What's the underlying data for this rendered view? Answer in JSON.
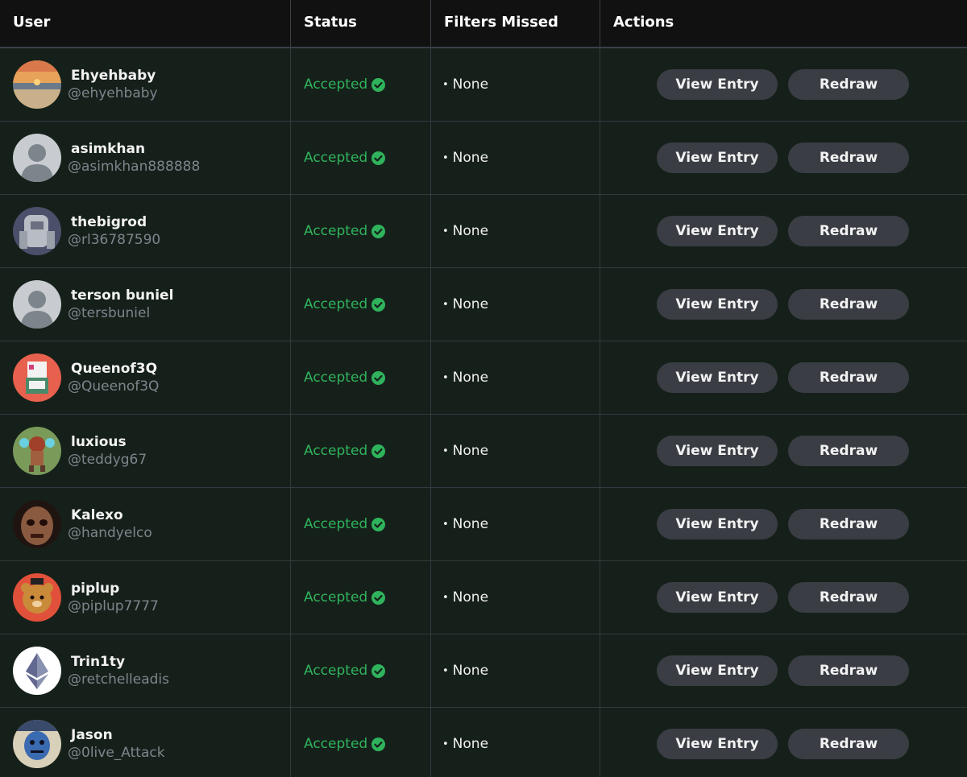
{
  "columns": {
    "user": "User",
    "status": "Status",
    "filters": "Filters Missed",
    "actions": "Actions"
  },
  "rows": [
    {
      "name": "Ehyehbaby",
      "handle": "@ehyehbaby",
      "status": "Accepted",
      "filters": "None",
      "avatar": "sunset-avatar"
    },
    {
      "name": "asimkhan",
      "handle": "@asimkhan888888",
      "status": "Accepted",
      "filters": "None",
      "avatar": "default-avatar"
    },
    {
      "name": "thebigrod",
      "handle": "@rl36787590",
      "status": "Accepted",
      "filters": "None",
      "avatar": "robot-avatar"
    },
    {
      "name": "terson buniel",
      "handle": "@tersbuniel",
      "status": "Accepted",
      "filters": "None",
      "avatar": "default-avatar"
    },
    {
      "name": "Queenof3Q",
      "handle": "@Queenof3Q",
      "status": "Accepted",
      "filters": "None",
      "avatar": "pixel-creature-avatar"
    },
    {
      "name": "luxious",
      "handle": "@teddyg67",
      "status": "Accepted",
      "filters": "None",
      "avatar": "bug-robot-avatar"
    },
    {
      "name": "Kalexo",
      "handle": "@handyelco",
      "status": "Accepted",
      "filters": "None",
      "avatar": "skull-face-avatar"
    },
    {
      "name": "piplup",
      "handle": "@piplup7777",
      "status": "Accepted",
      "filters": "None",
      "avatar": "bear-avatar"
    },
    {
      "name": "Trin1ty",
      "handle": "@retchelleadis",
      "status": "Accepted",
      "filters": "None",
      "avatar": "ethereum-avatar"
    },
    {
      "name": "Jason",
      "handle": "@0live_Attack",
      "status": "Accepted",
      "filters": "None",
      "avatar": "blue-character-avatar"
    }
  ],
  "actions": {
    "view_label": "View Entry",
    "redraw_label": "Redraw"
  },
  "colors": {
    "accepted": "#2fb35c",
    "button_bg": "#3a3d44",
    "row_bg": "#16201a",
    "header_bg": "#111111"
  }
}
